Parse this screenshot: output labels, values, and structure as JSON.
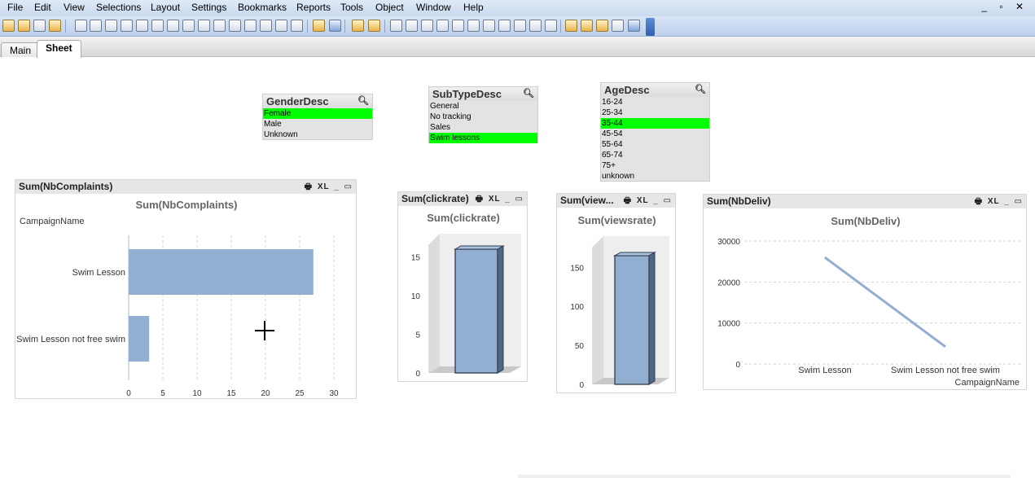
{
  "menu": [
    "File",
    "Edit",
    "View",
    "Selections",
    "Layout",
    "Settings",
    "Bookmarks",
    "Reports",
    "Tools",
    "Object",
    "Window",
    "Help"
  ],
  "window_controls": "_ ▫ ✕",
  "tabs": [
    "Main",
    "Sheet"
  ],
  "active_tab": "Sheet",
  "listboxes": {
    "gender": {
      "title": "GenderDesc",
      "items": [
        "Female",
        "Male",
        "Unknown"
      ],
      "selected": "Female"
    },
    "subtype": {
      "title": "SubTypeDesc",
      "items": [
        "General",
        "No tracking",
        "Sales",
        "Swim lessons"
      ],
      "selected": "Swim lessons"
    },
    "age": {
      "title": "AgeDesc",
      "items": [
        "16-24",
        "25-34",
        "35-44",
        "45-54",
        "55-64",
        "65-74",
        "75+",
        "unknown"
      ],
      "selected": "35-44"
    }
  },
  "chart_controls": {
    "print": "🖶",
    "xl": "XL",
    "minimize": "_",
    "maximize": "▭"
  },
  "colors": {
    "bar": "#92aed1",
    "line": "#92aed1",
    "selected": "#00ff00",
    "caption_bg": "#e6e6e6"
  },
  "chart_data": [
    {
      "id": "complaints",
      "type": "bar",
      "orientation": "horizontal",
      "caption": "Sum(NbComplaints)",
      "title": "Sum(NbComplaints)",
      "dimension_label": "CampaignName",
      "categories": [
        "Swim Lesson",
        "Swim Lesson not free swim"
      ],
      "values": [
        27,
        3
      ],
      "xlim": [
        0,
        30
      ],
      "ticks": [
        0,
        5,
        10,
        15,
        20,
        25,
        30
      ],
      "grid": true
    },
    {
      "id": "clickrate",
      "type": "bar",
      "style": "3d",
      "caption": "Sum(clickrate)",
      "title": "Sum(clickrate)",
      "categories": [
        ""
      ],
      "values": [
        16
      ],
      "ylim": [
        0,
        18
      ],
      "ticks": [
        0,
        5,
        10,
        15
      ]
    },
    {
      "id": "viewsrate",
      "type": "bar",
      "style": "3d",
      "caption": "Sum(view...",
      "title": "Sum(viewsrate)",
      "categories": [
        ""
      ],
      "values": [
        165
      ],
      "ylim": [
        0,
        190
      ],
      "ticks": [
        0,
        50,
        100,
        150
      ]
    },
    {
      "id": "nbdeliv",
      "type": "line",
      "caption": "Sum(NbDeliv)",
      "title": "Sum(NbDeliv)",
      "xlabel": "CampaignName",
      "categories": [
        "Swim Lesson",
        "Swim Lesson not free swim"
      ],
      "values": [
        26000,
        4200
      ],
      "ylim": [
        -1000,
        30000
      ],
      "ticks": [
        0,
        10000,
        20000,
        30000
      ],
      "grid": true
    }
  ]
}
